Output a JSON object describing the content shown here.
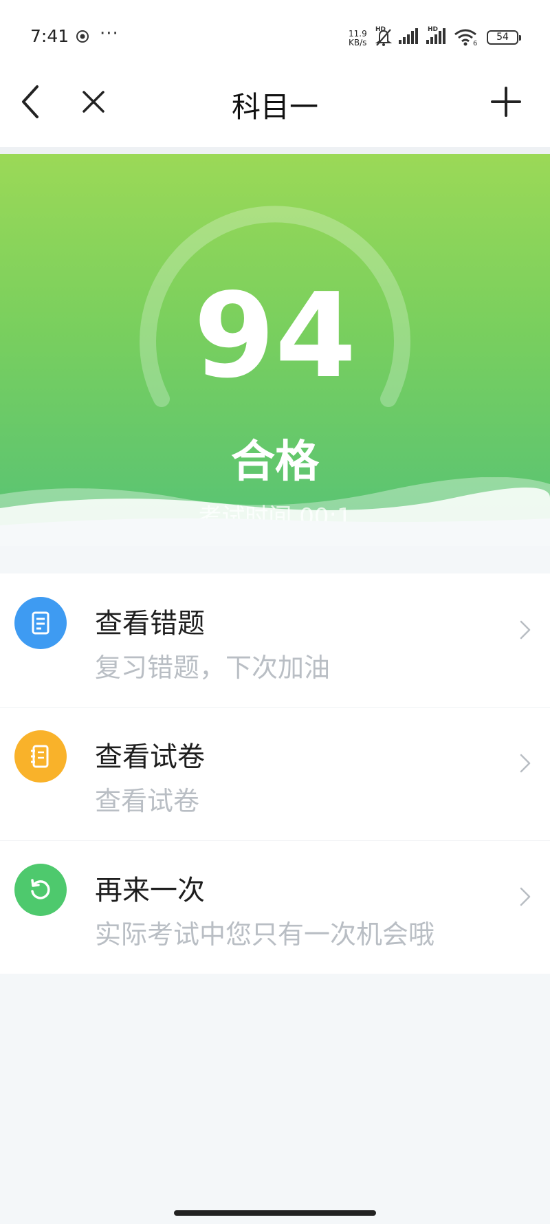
{
  "status_bar": {
    "time": "7:41",
    "more": "···",
    "net_speed_value": "11.9",
    "net_speed_unit": "KB/s",
    "signal_1_label": "HD",
    "signal_2_label": "HD",
    "wifi_badge": "6",
    "battery": "54"
  },
  "nav": {
    "title": "科目一"
  },
  "result": {
    "score": "94",
    "status": "合格",
    "exam_time": "考试时间 00:1"
  },
  "actions": [
    {
      "title": "查看错题",
      "subtitle": "复习错题，下次加油",
      "icon": "document-list-icon",
      "color": "#3e9bf2"
    },
    {
      "title": "查看试卷",
      "subtitle": "查看试卷",
      "icon": "notebook-icon",
      "color": "#f9b22a"
    },
    {
      "title": "再来一次",
      "subtitle": "实际考试中您只有一次机会哦",
      "icon": "retry-icon",
      "color": "#4ec96d"
    }
  ],
  "colors": {
    "hero_top": "#9bd957",
    "hero_bottom": "#55c276",
    "page_background": "#f4f7f9"
  }
}
